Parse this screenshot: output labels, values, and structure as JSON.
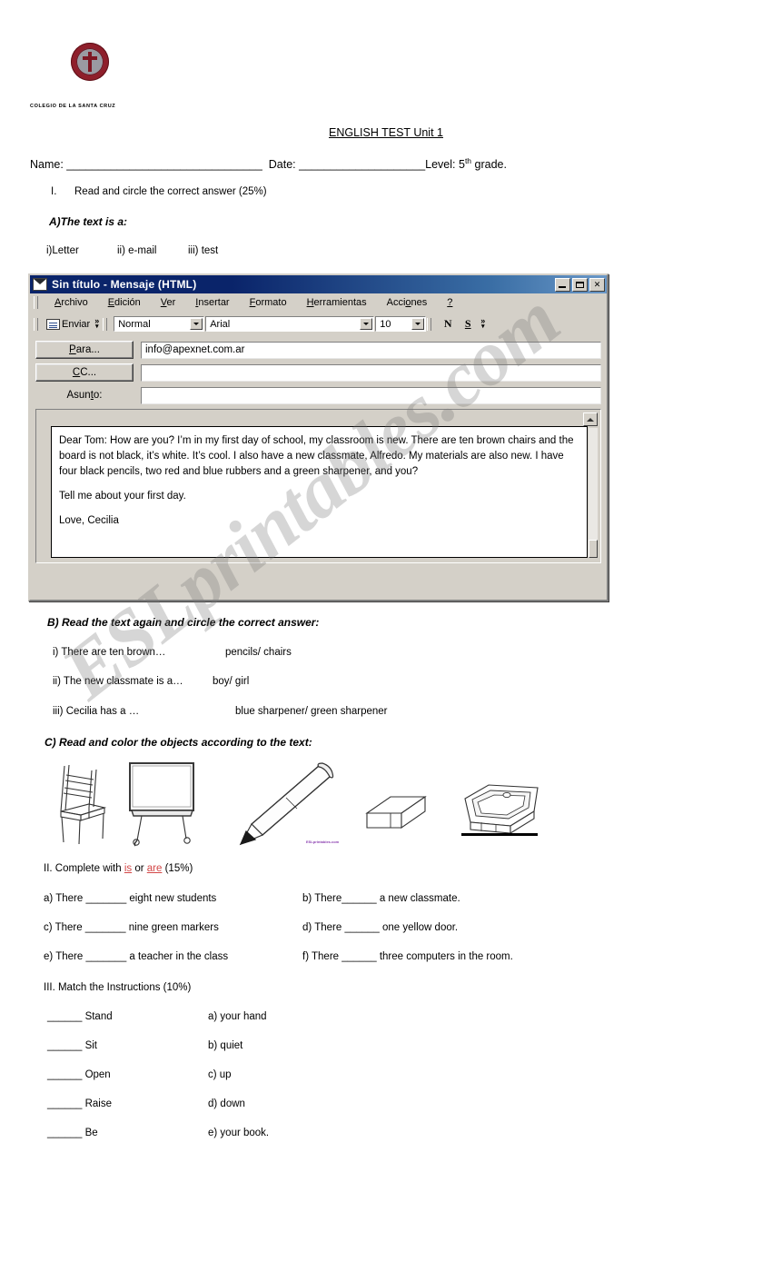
{
  "document": {
    "school_name": "COLEGIO DE LA SANTA CRUZ",
    "title": "ENGLISH TEST Unit 1",
    "name_label": "Name: _______________________________",
    "date_label": "Date: ____________________",
    "level_prefix": "Level: 5",
    "level_sup": "th",
    "level_suffix": " grade."
  },
  "section_I": {
    "number": "I.",
    "instruction": "Read and circle the correct answer (25%)",
    "part_a": {
      "heading": "A)The text is a:",
      "options": [
        "i)Letter",
        "ii) e-mail",
        "iii) test"
      ]
    },
    "part_b": {
      "heading": "B) Read the text again and circle the correct answer:",
      "rows": [
        {
          "question": "i) There are ten brown…",
          "answers": "pencils/ chairs"
        },
        {
          "question": "ii) The new classmate is a…",
          "answers": "boy/ girl"
        },
        {
          "question": "iii) Cecilia has a …",
          "answers": "blue sharpener/ green sharpener"
        }
      ]
    },
    "part_c": {
      "heading": "C) Read and color the objects according to the text:",
      "objects": [
        "chair",
        "whiteboard",
        "pencil",
        "eraser",
        "sharpener"
      ],
      "image_tag": "ESLprintables.com"
    }
  },
  "email_window": {
    "title": "Sin título - Mensaje (HTML)",
    "window_icon": "envelope-icon",
    "controls": {
      "minimize": "–",
      "maximize": "□",
      "close": "✕"
    },
    "menu": [
      "Archivo",
      "Edición",
      "Ver",
      "Insertar",
      "Formato",
      "Herramientas",
      "Acciones",
      "?"
    ],
    "toolbar": {
      "send_label": "Enviar",
      "send_icon": "send-envelope-icon",
      "overflow": "»",
      "style_value": "Normal",
      "font_value": "Arial",
      "size_value": "10",
      "bold_label": "N",
      "underline_label": "S"
    },
    "fields": {
      "to_button": "Para...",
      "to_value": "info@apexnet.com.ar",
      "cc_button": "CC...",
      "cc_value": "",
      "subject_label": "Asunto:",
      "subject_value": ""
    },
    "body": {
      "paragraph1": "Dear Tom: How are you? I’m in my first day of school, my classroom is new. There are ten brown chairs and the board is not black, it’s white. It’s cool. I also have a new classmate, Alfredo.  My materials are also new. I have four black pencils, two red and blue rubbers and a green sharpener, and you?",
      "paragraph2": "Tell me about your first day.",
      "paragraph3": "Love, Cecilia"
    }
  },
  "section_II": {
    "heading_before": "II. Complete with ",
    "word_is": "is",
    "heading_mid": " or ",
    "word_are": "are",
    "heading_after": " (15%)",
    "items": [
      {
        "left": "a) There _______ eight new students",
        "right": "b) There______ a new classmate."
      },
      {
        "left": "c) There _______ nine green markers",
        "right": "d) There ______ one yellow door."
      },
      {
        "left": "e) There _______ a teacher in the class",
        "right": "f) There ______ three computers in the room."
      }
    ]
  },
  "section_III": {
    "heading": "III. Match the Instructions (10%)",
    "items": [
      {
        "left": "______ Stand",
        "right": "a) your hand"
      },
      {
        "left": "______ Sit",
        "right": "b) quiet"
      },
      {
        "left": "______ Open",
        "right": "c) up"
      },
      {
        "left": "______ Raise",
        "right": "d) down"
      },
      {
        "left": "______ Be",
        "right": "e) your book."
      }
    ]
  },
  "watermark": {
    "text": "ESLprintables.com"
  }
}
